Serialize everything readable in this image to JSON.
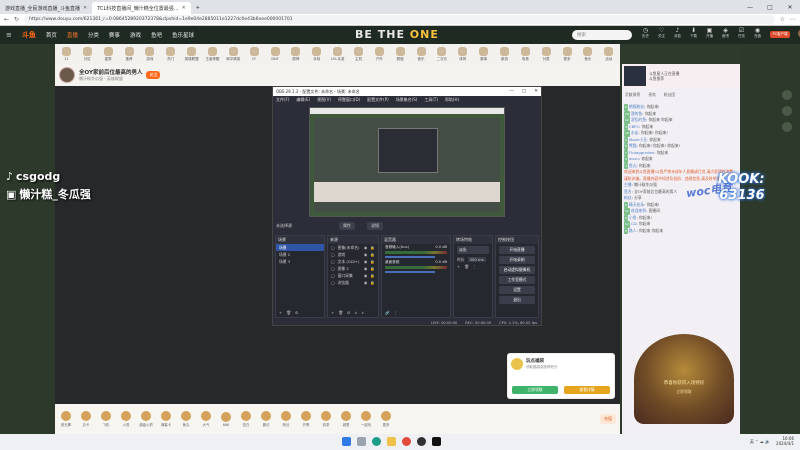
{
  "browser": {
    "tabs": [
      {
        "title": "游戏直播_全民游戏直播_斗鱼直播",
        "active": false
      },
      {
        "title": "TCL科技直播间_懒汁糕全位置最强...",
        "active": true
      }
    ],
    "url": "https://www.douyu.com/621361_r=0.0864528920372378&clpshid=1e9e04e2885011e1227dc0e43b6eee000001701",
    "window_controls": [
      "—",
      "□",
      "✕"
    ]
  },
  "site": {
    "logo": "斗鱼",
    "nav": [
      {
        "label": "首页",
        "active": false
      },
      {
        "label": "直播",
        "active": true
      },
      {
        "label": "分类",
        "active": false
      },
      {
        "label": "赛事",
        "active": false
      },
      {
        "label": "游戏",
        "active": false
      },
      {
        "label": "鱼吧",
        "active": false
      },
      {
        "label": "鱼乐星球",
        "active": false
      }
    ],
    "banner_prefix": "BE THE ",
    "banner_suffix": "ONE",
    "search_placeholder": "搜索",
    "header_icons": [
      {
        "label": "历史",
        "icon": "history-icon"
      },
      {
        "label": "关注",
        "icon": "heart-icon"
      },
      {
        "label": "消息",
        "icon": "bell-icon"
      },
      {
        "label": "下载",
        "icon": "download-icon"
      },
      {
        "label": "开播",
        "icon": "camera-icon"
      },
      {
        "label": "鱼吧",
        "icon": "fish-icon"
      },
      {
        "label": "任务",
        "icon": "task-icon"
      },
      {
        "label": "充值",
        "icon": "wallet-icon"
      }
    ],
    "pc_badge": "PC客户端"
  },
  "categories": [
    "11",
    "分区",
    "星秀",
    "推荐",
    "游戏",
    "热门",
    "英雄联盟",
    "王者荣耀",
    "和平精英",
    "CF",
    "DNF",
    "原神",
    "永劫",
    "LOL手游",
    "主机",
    "户外",
    "颜值",
    "音乐",
    "二次元",
    "体育",
    "赛事",
    "新游",
    "电竞",
    "分类",
    "更多",
    "鱼乐",
    "活动"
  ],
  "streamer": {
    "room_title": "全OY家前后位最高的男人",
    "sub": "懒汁糕冬瓜强 · 英雄联盟",
    "follow": "关注"
  },
  "obs": {
    "title": "OBS 29.1.3 - 配置文件: 未命名 - 场景: 未命名",
    "window_controls": [
      "—",
      "□",
      "✕"
    ],
    "menu": [
      "文件(F)",
      "编辑(E)",
      "视图(V)",
      "停靠窗口(D)",
      "配置文件(P)",
      "场景集合(S)",
      "工具(T)",
      "帮助(H)"
    ],
    "no_source": "未选择源",
    "source_buttons": [
      "属性",
      "滤镜"
    ],
    "scenes_header": "场景",
    "scenes": [
      "场景",
      "场景 2",
      "场景 3"
    ],
    "sources_header": "来源",
    "sources": [
      "图像(未命名)",
      "游戏",
      "文本 (GDI+)",
      "图像 2",
      "窗口采集",
      "浏览器"
    ],
    "mixer_header": "混音器",
    "mixer": [
      {
        "name": "音频输入(Aux)",
        "db": "0.0 dB"
      },
      {
        "name": "桌面音频",
        "db": "0.0 dB"
      }
    ],
    "transitions_header": "转场特效",
    "transition": "淡出",
    "duration_label": "时长",
    "duration": "300 ms",
    "controls_header": "控制按钮",
    "controls": [
      "开始直播",
      "开始录制",
      "启动虚拟摄像机",
      "工作室模式",
      "设置",
      "退出"
    ],
    "status": [
      "LIVE: 00:00:00",
      "REC: 00:00:00",
      "CPU: 1.1%, 60.00 fps"
    ]
  },
  "sidebar": {
    "mini_player_text": "斗鱼星人正在直播",
    "mini_player_sub": "斗鱼推荐",
    "rank_tabs": [
      "贡献周榜",
      "贵宾",
      "粉丝团"
    ],
    "chat": [
      {
        "badge": "6",
        "user": "朗报粉丝",
        "text": "你起来!"
      },
      {
        "badge": "18",
        "user": "我的鱼",
        "text": "你起来"
      },
      {
        "badge": "12",
        "user": "凌乱的鱼",
        "text": "你起来 你起来"
      },
      {
        "badge": "9",
        "user": "CBPC",
        "text": "你起来"
      },
      {
        "badge": "10",
        "user": "水友",
        "text": "你起来! 你起来!"
      },
      {
        "badge": "5",
        "user": "Moon小丑",
        "text": "你起来"
      },
      {
        "badge": "8",
        "user": "熊猫",
        "text": "你起来! 你起来! 你起来!"
      },
      {
        "badge": "7",
        "user": "Flutaggrnden",
        "text": "你起来"
      },
      {
        "badge": "4",
        "user": "wuzu",
        "text": "你起来"
      },
      {
        "badge": "3",
        "user": "鱼丸",
        "text": "你起来"
      },
      {
        "notice": true,
        "text": "欢迎来到斗鱼直播!斗鱼严禁未成年人直播或打赏,请大家理性消费,谨防诈骗。直播内容中如涉及低俗、违规信息,请及时举报。"
      },
      {
        "badge": "",
        "user": "主播",
        "text": "懒汁糕冬瓜强"
      },
      {
        "badge": "",
        "user": "签名",
        "text": "全OY家前后位最高的男人"
      },
      {
        "badge": "",
        "user": "粉丝",
        "text": "分享"
      },
      {
        "badge": "6",
        "user": "晴天花朵",
        "text": "你起来!"
      },
      {
        "badge": "11",
        "user": "欢迎来到",
        "text": "直播间"
      },
      {
        "badge": "9",
        "user": "小鱼",
        "text": "你起来!"
      },
      {
        "badge": "12",
        "user": "CD",
        "text": "你起来"
      },
      {
        "badge": "8",
        "user": "路人",
        "text": "你起来 你起来"
      }
    ]
  },
  "gift_card": {
    "title": "玩点福袋",
    "sub": "领取福袋奖励得积分",
    "buttons": [
      "立即领取",
      "查看详情"
    ]
  },
  "award": {
    "title": "恭喜你获得入场特权",
    "sub": "立即领取"
  },
  "gifts": [
    "荧光棒",
    "办卡",
    "飞机",
    "火箭",
    "超级火箭",
    "弹幕卡",
    "鱼丸",
    "大气",
    "666",
    "告白",
    "魔法",
    "粉丝",
    "开黑",
    "奶茶",
    "城堡",
    "一起玩",
    "更多"
  ],
  "recharge": "充值",
  "overlay": {
    "name1": "csgodg",
    "name2": "懒汁糕_冬瓜强",
    "kook1": "KOOK:",
    "kook2": "63136",
    "woc": "woc电竞"
  },
  "taskbar": {
    "time": "16:06",
    "date": "2024/4/1",
    "tray": "英 ⌃ ☁ 🔊"
  },
  "colors": {
    "accent": "#ff6a1a",
    "obs_bg": "#2b2e38",
    "obs_selected": "#2f55a4"
  }
}
